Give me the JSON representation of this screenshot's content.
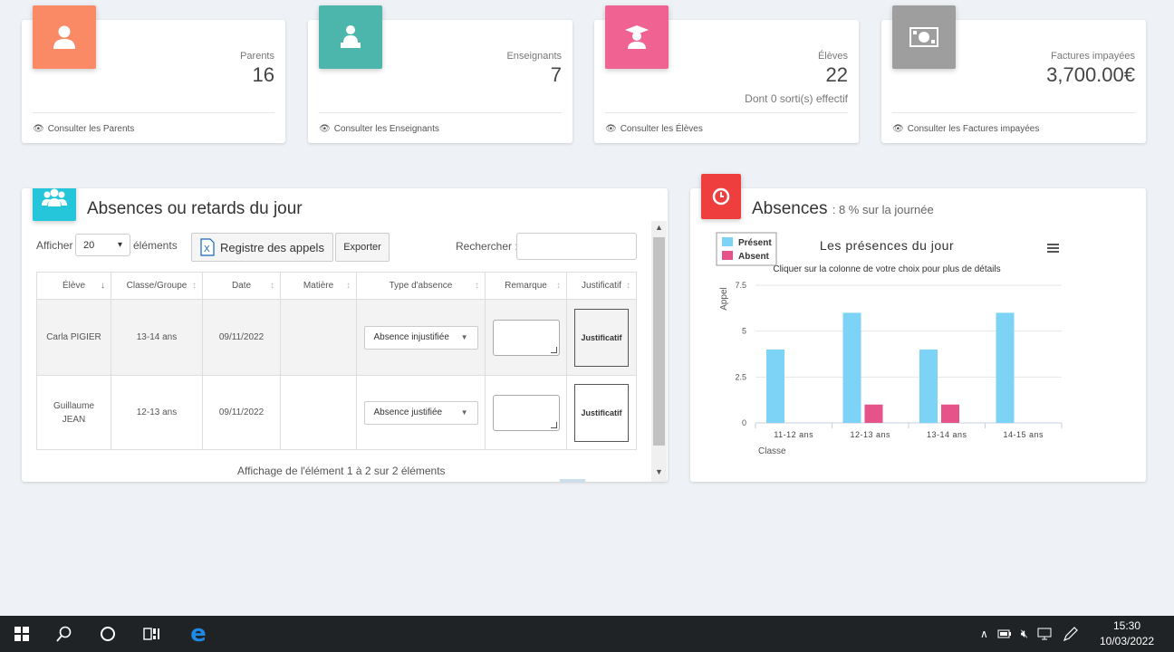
{
  "stats": [
    {
      "label": "Parents",
      "value": "16",
      "sub": "",
      "link": "Consulter les Parents",
      "color": "#fa8a65",
      "icon": "user-icon"
    },
    {
      "label": "Enseignants",
      "value": "7",
      "sub": "",
      "link": "Consulter les Enseignants",
      "color": "#4db6ac",
      "icon": "teacher-icon"
    },
    {
      "label": "Élèves",
      "value": "22",
      "sub": "Dont 0 sorti(s) effectif",
      "link": "Consulter les Élèves",
      "color": "#f06292",
      "icon": "graduate-icon"
    },
    {
      "label": "Factures impayées",
      "value": "3,700.00€",
      "sub": "",
      "link": "Consulter les Factures impayées",
      "color": "#9e9e9e",
      "icon": "money-icon"
    }
  ],
  "absences_panel": {
    "title": "Absences ou retards du jour",
    "show_label": "Afficher",
    "page_size": "20",
    "elements_label": "éléments",
    "register_button": "Registre des appels",
    "export_button": "Exporter",
    "search_label": "Rechercher :",
    "search_value": "",
    "columns": [
      "Élève",
      "Classe/Groupe",
      "Date",
      "Matière",
      "Type d'absence",
      "Remarque",
      "Justificatif"
    ],
    "rows": [
      {
        "student": "Carla PIGIER",
        "group": "13-14 ans",
        "date": "09/11/2022",
        "subject": "",
        "type": "Absence injustifiée",
        "justif": "Justificatif"
      },
      {
        "student": "Guillaume JEAN",
        "group": "12-13 ans",
        "date": "09/11/2022",
        "subject": "",
        "type": "Absence justifiée",
        "justif": "Justificatif"
      }
    ],
    "footer": "Affichage de l'élément 1 à 2 sur 2 éléments"
  },
  "chart_panel": {
    "title": "Absences",
    "subtitle": ": 8 % sur la journée"
  },
  "chart_data": {
    "type": "bar",
    "title": "Les présences du jour",
    "subtitle": "Cliquer sur la colonne de votre choix pour plus de détails",
    "xlabel": "Classe",
    "ylabel": "Appel",
    "categories": [
      "11-12 ans",
      "12-13 ans",
      "13-14 ans",
      "14-15 ans"
    ],
    "series": [
      {
        "name": "Présent",
        "values": [
          4,
          6,
          4,
          6
        ],
        "color": "#7cd3f5"
      },
      {
        "name": "Absent",
        "values": [
          0,
          1,
          1,
          0
        ],
        "color": "#e6538a"
      }
    ],
    "yticks": [
      "0",
      "2.5",
      "5",
      "7.5"
    ],
    "ylim": [
      0,
      7.5
    ],
    "legend": "top-left",
    "grid": true
  },
  "taskbar": {
    "time": "15:30",
    "date": "10/03/2022"
  }
}
